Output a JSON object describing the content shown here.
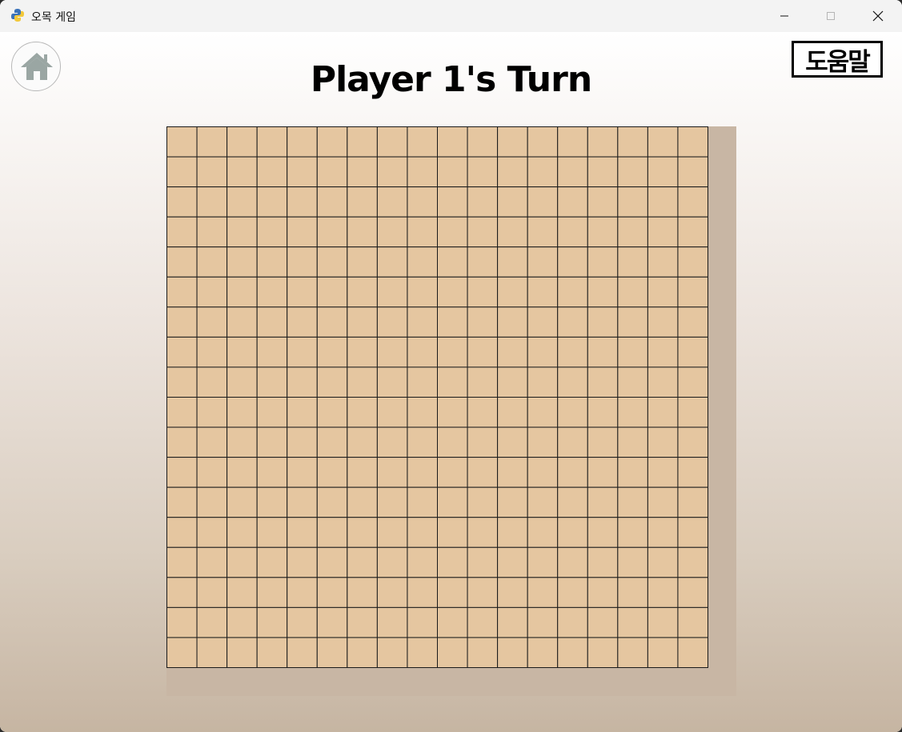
{
  "window": {
    "title": "오목 게임",
    "controls": {
      "minimize": "minimize",
      "maximize": "maximize",
      "close": "close"
    }
  },
  "header": {
    "turn_text": "Player 1's Turn",
    "help_label": "도움말",
    "home_icon": "home-icon"
  },
  "board": {
    "rows": 18,
    "cols": 18,
    "cell_color": "#e5c6a0",
    "line_color": "#1a1a1a",
    "shadow_color": "#c8b6a4"
  }
}
